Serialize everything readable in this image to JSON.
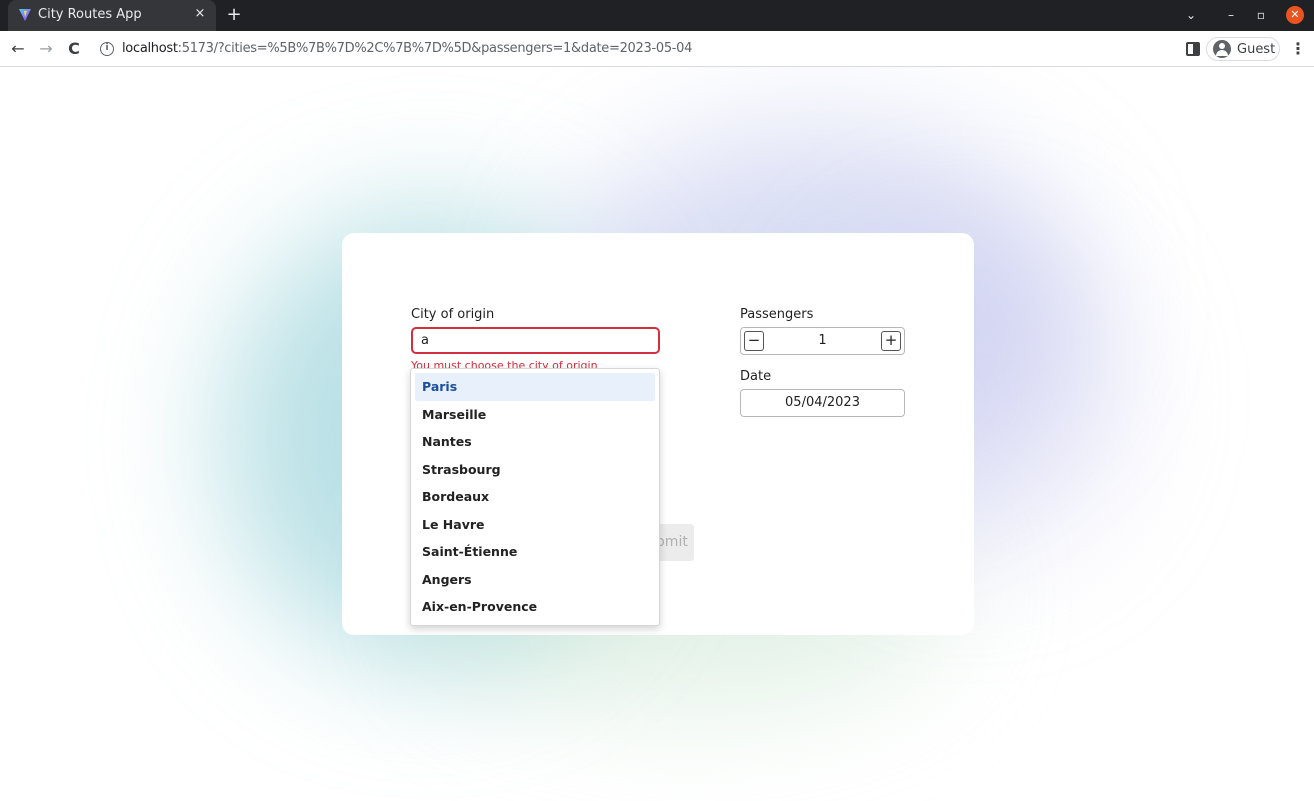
{
  "browser": {
    "tab_title": "City Routes App",
    "tab_close": "×",
    "new_tab": "+",
    "url_host": "localhost",
    "url_rest": ":5173/?cities=%5B%7B%7D%2C%7B%7D%5D&passengers=1&date=2023-05-04",
    "profile_label": "Guest",
    "nav_back": "←",
    "nav_forward": "→",
    "nav_reload": "C",
    "menu_glyph": "⋮",
    "window_controls": {
      "chevron": "⌄",
      "minimize": "–",
      "maximize": "▫",
      "close": "✕"
    }
  },
  "form": {
    "origin_label": "City of origin",
    "origin_value": "a",
    "origin_error": "You must choose the city of origin",
    "passengers_label": "Passengers",
    "passengers_value": "1",
    "minus_glyph": "−",
    "plus_glyph": "+",
    "date_label": "Date",
    "date_value": "05/04/2023",
    "submit_label": "Submit"
  },
  "dropdown": {
    "options": [
      "Paris",
      "Marseille",
      "Nantes",
      "Strasbourg",
      "Bordeaux",
      "Le Havre",
      "Saint-Étienne",
      "Angers",
      "Aix-en-Provence"
    ],
    "active_index": 0
  },
  "colors": {
    "error": "#d32f3f",
    "active_option_bg": "#e8f1fb",
    "active_option_text": "#1a4fa0",
    "tabbar": "#202124"
  }
}
